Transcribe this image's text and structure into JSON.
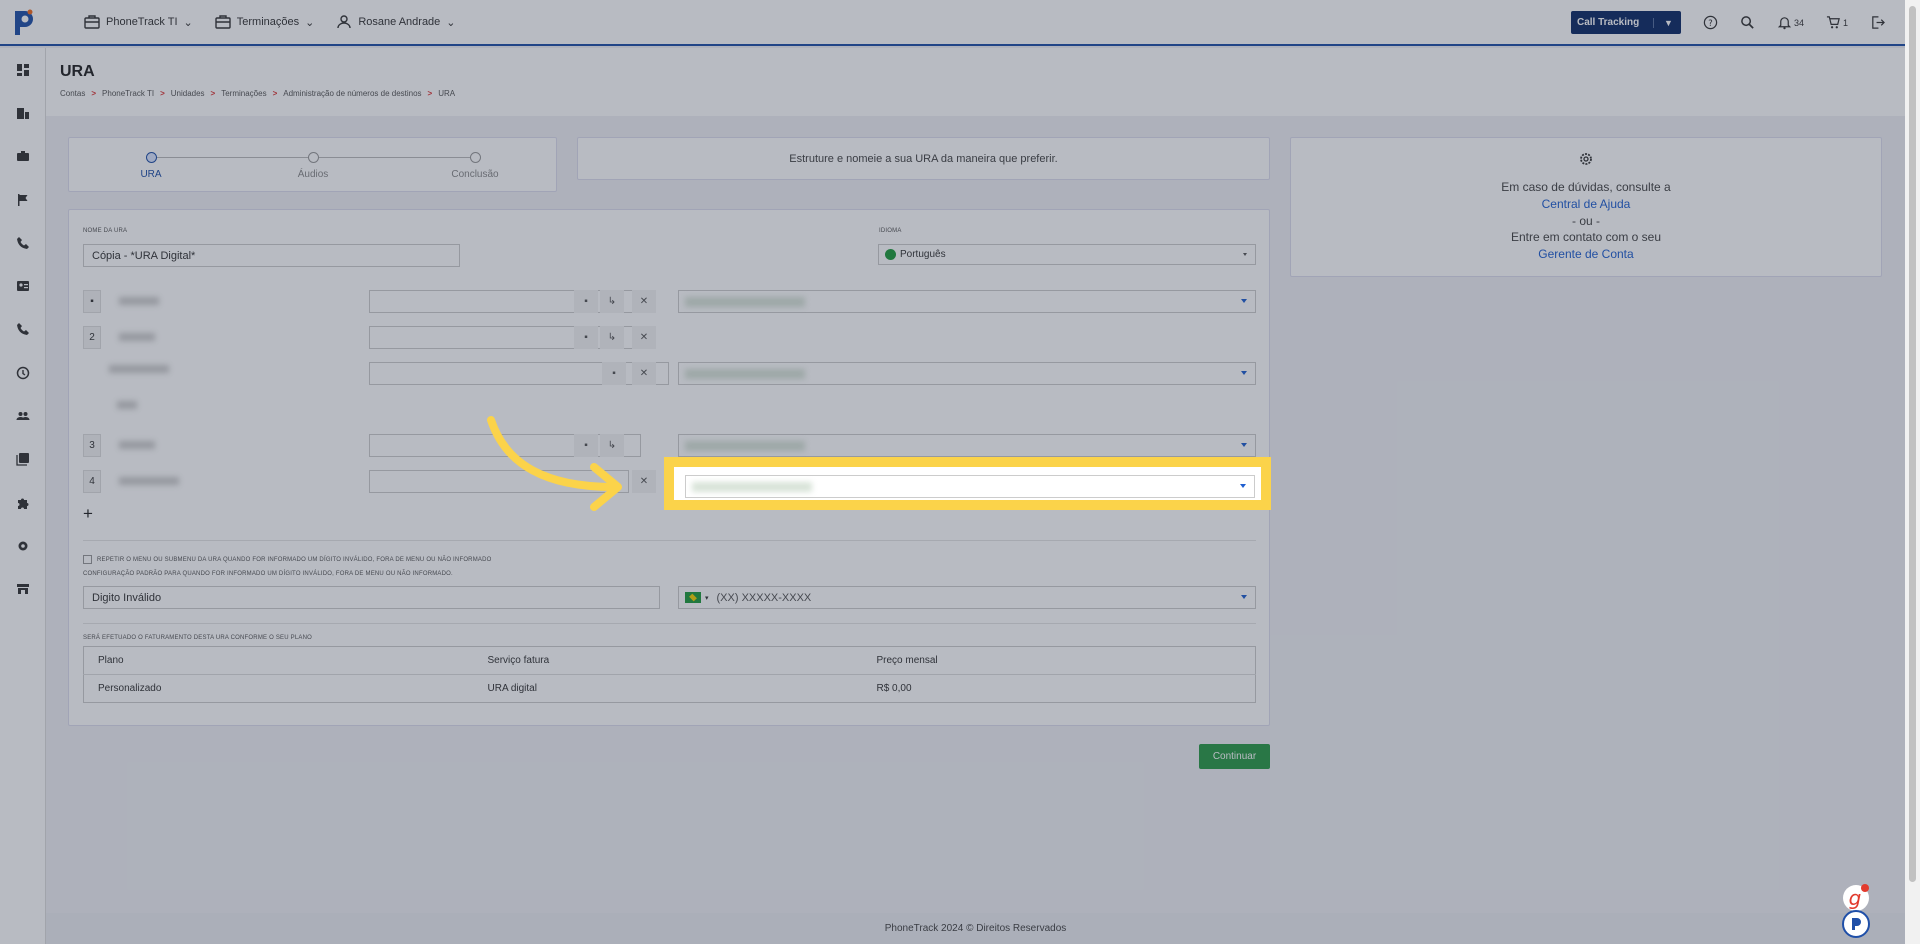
{
  "topbar": {
    "nav": [
      {
        "label": "PhoneTrack TI",
        "icon": "briefcase-icon"
      },
      {
        "label": "Terminações",
        "icon": "briefcase-icon"
      },
      {
        "label": "Rosane Andrade",
        "icon": "user-icon"
      }
    ],
    "product_button": "Call Tracking",
    "notifications_count": "34",
    "cart_count": "1"
  },
  "page": {
    "title": "URA",
    "breadcrumb": [
      "Contas",
      "PhoneTrack TI",
      "Unidades",
      "Terminações",
      "Administração de números de destinos",
      "URA"
    ]
  },
  "stepper": {
    "steps": [
      "URA",
      "Áudios",
      "Conclusão"
    ],
    "active": 0
  },
  "hint_text": "Estruture e nomeie a sua URA da maneira que preferir.",
  "help": {
    "line1": "Em caso de dúvidas, consulte a",
    "link1": "Central de Ajuda",
    "or": "- ou -",
    "line2": "Entre em contato com o seu",
    "link2": "Gerente de Conta"
  },
  "form": {
    "name_label": "Nome da URA",
    "name_value": "Cópia - *URA Digital*",
    "language_label": "Idioma",
    "language_value": "Português",
    "rows": [
      "2",
      "3",
      "4"
    ],
    "checkbox_label": "Repetir o menu ou submenu da URA quando for informado um dígito inválido, fora de menu ou não informado",
    "default_config_label": "Configuração padrão para quando for informado um dígito inválido, fora de menu ou não informado.",
    "invalid_digit_value": "Digito Inválido",
    "phone_placeholder": "(XX) XXXXX-XXXX",
    "billing_label": "Será efetuado o faturamento desta URA conforme o seu plano",
    "table": {
      "headers": [
        "Plano",
        "Serviço fatura",
        "Preço mensal"
      ],
      "row": [
        "Personalizado",
        "URA digital",
        "R$ 0,00"
      ]
    },
    "add_symbol": "+"
  },
  "continue_label": "Continuar",
  "footer": "PhoneTrack 2024 © Direitos Reservados",
  "colors": {
    "brand_blue": "#1f4fa8",
    "navy": "#0d2a66",
    "continue_green": "#2b9a46",
    "highlight_yellow": "#fbd34a"
  }
}
